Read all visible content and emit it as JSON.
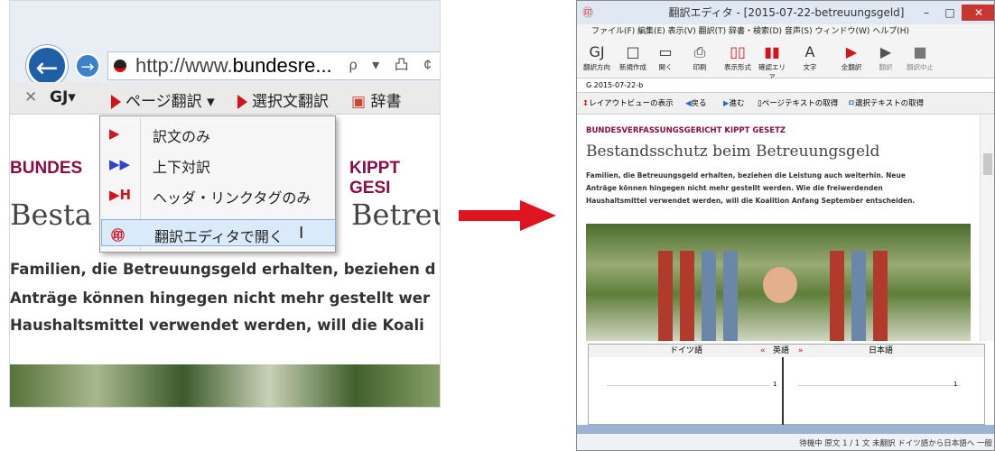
{
  "browser": {
    "url_prefix": "http://www.",
    "url_bold": "bundesre...",
    "url_tools": "ρ ▾ 凸 ¢",
    "toolbar": {
      "close": "✕",
      "gj": "GJ▾",
      "page_translate": "ページ翻訳 ▾",
      "selection_translate": "選択文翻訳",
      "dictionary": "辞書"
    },
    "page": {
      "heading_left": "BUNDES",
      "heading_right": "KIPPT GESI",
      "title_left": "Besta",
      "title_right": "Betreu",
      "body": [
        "Familien, die Betreuungsgeld erhalten, beziehen d",
        "Anträge können hingegen nicht mehr gestellt wer",
        "Haushaltsmittel verwendet werden, will die Koali"
      ]
    },
    "menu": [
      {
        "icon": "▶",
        "label": "訳文のみ"
      },
      {
        "icon": "▶▶",
        "label": "上下対訳"
      },
      {
        "icon": "▶H",
        "label": "ヘッダ・リンクタグのみ"
      },
      {
        "icon": "㊞",
        "label": "翻訳エディタで開く"
      }
    ]
  },
  "editor": {
    "title": "翻訳エディタ - [2015-07-22-betreuungsgeld]",
    "menu": "ファイル(F)  編集(E)  表示(V)  翻訳(T)  辞書・検索(D)  音声(S)  ウィンドウ(W)  ヘルプ(H)",
    "toolbar": [
      {
        "icon": "GJ",
        "label": "翻訳方向"
      },
      {
        "icon": "□",
        "label": "新規作成"
      },
      {
        "icon": "▭",
        "label": "開く"
      },
      {
        "icon": "⎙",
        "label": "印刷"
      },
      {
        "icon": "▯▯",
        "label": "表示形式"
      },
      {
        "icon": "▮▮",
        "label": "確認エリア"
      },
      {
        "icon": "A",
        "label": "文字"
      },
      {
        "icon": "▶",
        "label": "全翻訳"
      },
      {
        "icon": "▶",
        "label": "翻訳"
      },
      {
        "icon": "■",
        "label": "翻訳中止"
      }
    ],
    "tab": "G 2015-07-22-b",
    "nav": {
      "layout": "レイアウトビューの表示",
      "back": "戻る",
      "forward": "進む",
      "get_page_text": "ページテキストの取得",
      "get_selection_text": "選択テキストの取得"
    },
    "view": {
      "heading": "BUNDESVERFASSUNGSGERICHT KIPPT GESETZ",
      "title": "Bestandsschutz beim Betreuungsgeld",
      "body": [
        "Familien, die Betreuungsgeld erhalten, beziehen die Leistung auch weiterhin. Neue",
        "Anträge können hingegen nicht mehr gestellt werden. Wie die freiwerdenden",
        "Haushaltsmittel verwendet werden, will die Koalition Anfang September entscheiden."
      ]
    },
    "trans_headers": {
      "german": "ドイツ語",
      "english": "英語",
      "japanese": "日本語"
    },
    "row_numbers": [
      "1",
      "1"
    ],
    "status": "待機中  原文  1 / 1 文  未翻訳  ドイツ語から日本語へ  一般"
  },
  "colors": {
    "accent_red": "#d3121c",
    "heading_purple": "#8a0c45",
    "nav_blue": "#1f5fa8"
  }
}
